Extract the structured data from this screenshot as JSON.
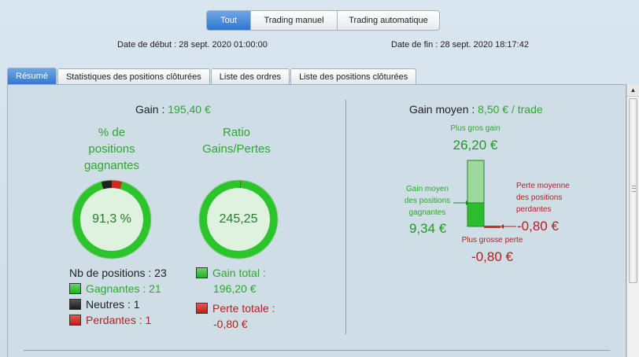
{
  "filters": {
    "all": "Tout",
    "manual": "Trading manuel",
    "auto": "Trading automatique"
  },
  "dates": {
    "start_label": "Date de début :",
    "start_value": "28 sept. 2020 01:00:00",
    "end_label": "Date de fin :",
    "end_value": "28 sept. 2020 18:17:42"
  },
  "tabs": [
    {
      "label": "Résumé",
      "active": true
    },
    {
      "label": "Statistiques des positions clôturées",
      "active": false
    },
    {
      "label": "Liste des ordres",
      "active": false
    },
    {
      "label": "Liste des positions clôturées",
      "active": false
    }
  ],
  "summary": {
    "gain_label": "Gain :",
    "gain_value": "195,40 €",
    "winning_pct_title_1": "% de",
    "winning_pct_title_2": "positions",
    "winning_pct_title_3": "gagnantes",
    "winning_pct_value": "91,3 %",
    "ratio_title_1": "Ratio",
    "ratio_title_2": "Gains/Pertes",
    "ratio_value": "245,25",
    "positions_count_label": "Nb de positions : 23",
    "winners_label": "Gagnantes : 21",
    "neutral_label": "Neutres : 1",
    "losers_label": "Perdantes : 1",
    "total_gain_label": "Gain total :",
    "total_gain_value": "196,20 €",
    "total_loss_label": "Perte totale :",
    "total_loss_value": "-0,80 €"
  },
  "average": {
    "title_label": "Gain moyen :",
    "title_value": "8,50 € / trade",
    "biggest_gain_label": "Plus gros gain",
    "biggest_gain_value": "26,20 €",
    "avg_win_label_1": "Gain moyen",
    "avg_win_label_2": "des positions",
    "avg_win_label_3": "gagnantes",
    "avg_win_value": "9,34 €",
    "avg_loss_label_1": "Perte moyenne",
    "avg_loss_label_2": "des positions",
    "avg_loss_label_3": "perdantes",
    "avg_loss_value": "-0,80 €",
    "biggest_loss_label": "Plus grosse perte",
    "biggest_loss_value": "-0,80 €"
  },
  "chart_data": [
    {
      "type": "pie",
      "categories": [
        "Gagnantes",
        "Neutres",
        "Perdantes"
      ],
      "values": [
        21,
        1,
        1
      ],
      "colors": [
        "#2bc42b",
        "#222222",
        "#cc2a22"
      ]
    },
    {
      "type": "pie",
      "categories": [
        "Gain total",
        "Perte totale"
      ],
      "values": [
        196.2,
        0.8
      ],
      "colors": [
        "#2bc42b",
        "#cc2a22"
      ]
    }
  ],
  "colors": {
    "accent_blue": "#2f76cf",
    "gain_green": "#2ea82e",
    "loss_red": "#b22222"
  }
}
